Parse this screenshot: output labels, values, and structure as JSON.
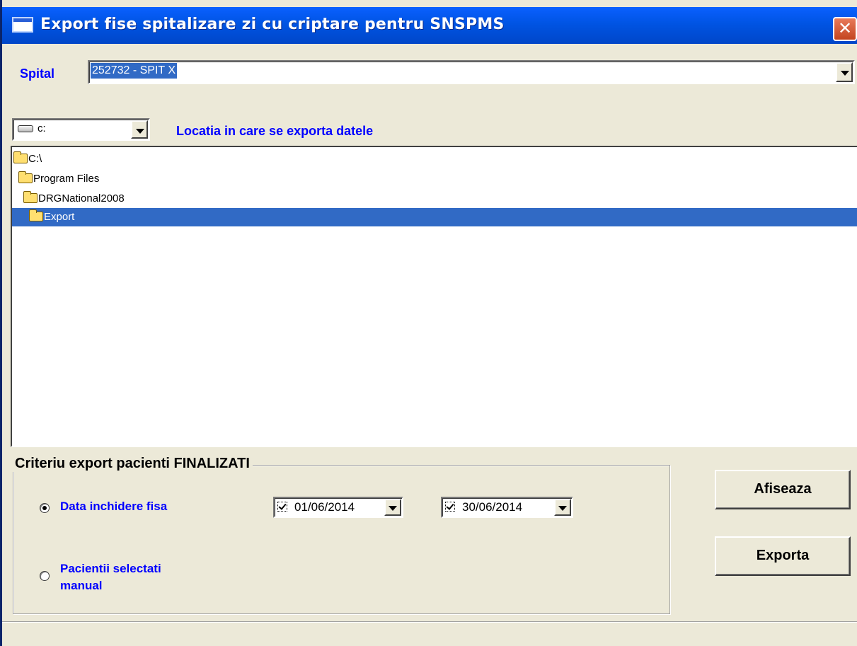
{
  "window": {
    "title": "Export fise spitalizare zi cu criptare pentru SNSPMS",
    "close_glyph": "✕"
  },
  "spital": {
    "label": "Spital",
    "value": "252732 - SPIT X"
  },
  "drive": {
    "value": "c:",
    "location_label": "Locatia in care se exporta datele"
  },
  "tree": {
    "items": [
      {
        "label": "C:\\",
        "indent": 0,
        "selected": false
      },
      {
        "label": "Program Files",
        "indent": 1,
        "selected": false
      },
      {
        "label": "DRGNational2008",
        "indent": 2,
        "selected": false
      },
      {
        "label": "Export",
        "indent": 3,
        "selected": true
      }
    ]
  },
  "criteria": {
    "title": "Criteriu export pacienti FINALIZATI",
    "option_date": "Data inchidere fisa",
    "option_manual_line1": "Pacientii selectati",
    "option_manual_line2": "manual",
    "date_from": "01/06/2014",
    "date_to": "30/06/2014",
    "selected_option": "Data inchidere fisa"
  },
  "buttons": {
    "show": "Afiseaza",
    "export": "Exporta"
  },
  "colors": {
    "titlebar": "#0054e3",
    "label_blue": "#0000ff",
    "selection": "#316ac5",
    "window_bg": "#ece9d8"
  }
}
